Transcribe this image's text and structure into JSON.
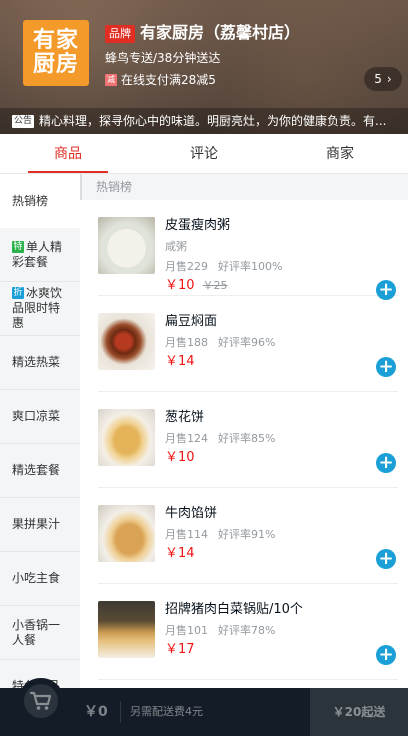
{
  "header": {
    "logo_line1": "有家",
    "logo_line2": "厨房",
    "brand_badge": "品牌",
    "shop_name": "有家厨房（荔馨村店）",
    "delivery_info": "蜂鸟专送/38分钟送达",
    "promo_icon": "减",
    "promo_text": "在线支付满28减5",
    "promo_count": "5",
    "notice_badge": "公告",
    "notice_text": "精心料理，探寻你心中的味道。明厨亮灶，为你的健康负责。有..."
  },
  "tabs": [
    {
      "label": "商品",
      "active": true
    },
    {
      "label": "评论",
      "active": false
    },
    {
      "label": "商家",
      "active": false
    }
  ],
  "menu": {
    "items": [
      {
        "label": "热销榜"
      },
      {
        "tag": "特",
        "tag_color": "#2bb24c",
        "label": "单人精彩套餐"
      },
      {
        "tag": "折",
        "tag_color": "#1a9fd6",
        "label": "冰爽饮品限时特惠"
      },
      {
        "label": "精选热菜"
      },
      {
        "label": "爽口凉菜"
      },
      {
        "label": "精选套餐"
      },
      {
        "label": "果拼果汁"
      },
      {
        "label": "小吃主食"
      },
      {
        "label": "小香锅一人餐"
      },
      {
        "label": "特色粥品"
      }
    ]
  },
  "section_title": "热销榜",
  "foods": [
    {
      "name": "皮蛋瘦肉粥",
      "desc": "咸粥",
      "sales": "月售229",
      "rating": "好评率100%",
      "price": "￥10",
      "old_price": "￥25",
      "image": "congee-photo"
    },
    {
      "name": "扁豆焖面",
      "sales": "月售188",
      "rating": "好评率96%",
      "price": "￥14",
      "image": "braised-noodles-photo"
    },
    {
      "name": "葱花饼",
      "sales": "月售124",
      "rating": "好评率85%",
      "price": "￥10",
      "image": "scallion-pancake-photo"
    },
    {
      "name": "牛肉馅饼",
      "sales": "月售114",
      "rating": "好评率91%",
      "price": "￥14",
      "image": "beef-pie-photo"
    },
    {
      "name": "招牌猪肉白菜锅贴/10个",
      "sales": "月售101",
      "rating": "好评率78%",
      "price": "￥17",
      "image": "potsticker-photo"
    }
  ],
  "icons": {
    "cart": "shopping-cart-icon",
    "add": "plus-icon",
    "chevron": "chevron-right-icon"
  },
  "cart": {
    "price": "￥0",
    "desc": "另需配送费4元",
    "min_order": "￥20起送"
  },
  "colors": {
    "accent_red": "#e02e24",
    "price_red": "#f01414",
    "add_blue": "#1a9fd6",
    "cart_bg": "#141d27"
  }
}
